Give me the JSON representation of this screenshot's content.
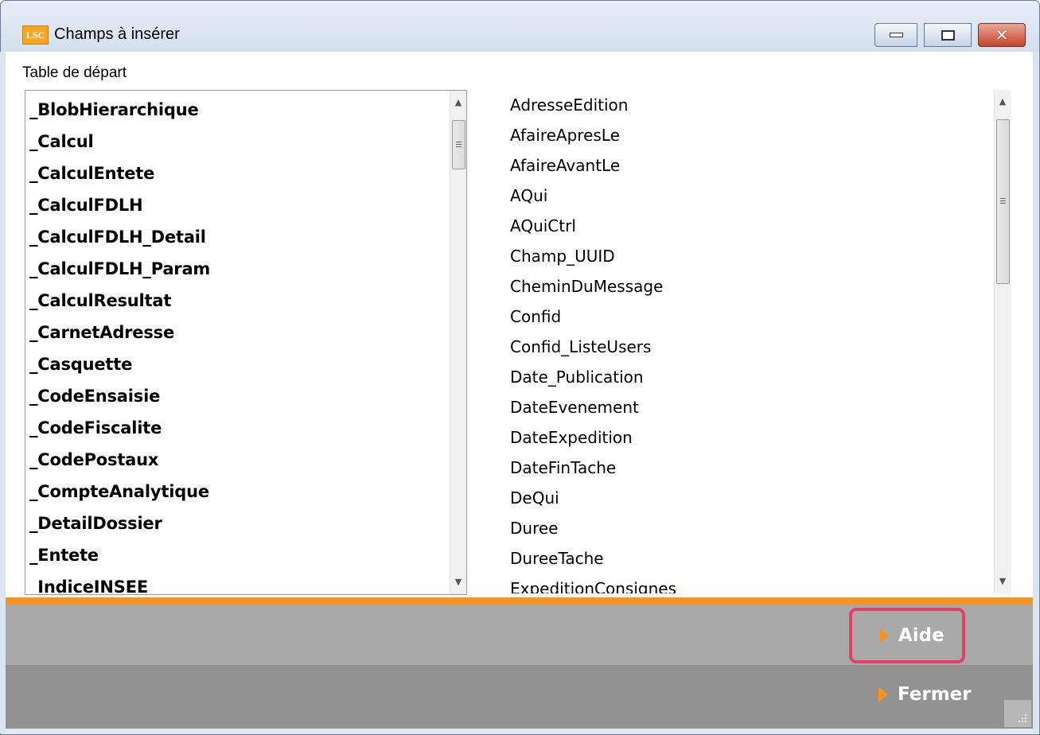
{
  "window": {
    "app_icon_text": "LSC",
    "title": "Champs à insérer"
  },
  "table_label": "Table de départ",
  "left_list": {
    "items": [
      "_BlobHierarchique",
      "_Calcul",
      "_CalculEntete",
      "_CalculFDLH",
      "_CalculFDLH_Detail",
      "_CalculFDLH_Param",
      "_CalculResultat",
      "_CarnetAdresse",
      "_Casquette",
      "_CodeEnsaisie",
      "_CodeFiscalite",
      "_CodePostaux",
      "_CompteAnalytique",
      "_DetailDossier",
      "_Entete",
      "_IndiceINSEE"
    ],
    "scroll_position": 0.05
  },
  "right_list": {
    "items": [
      "AdresseEdition",
      "AfaireApresLe",
      "AfaireAvantLe",
      "AQui",
      "AQuiCtrl",
      "Champ_UUID",
      "CheminDuMessage",
      "Confid",
      "Confid_ListeUsers",
      "Date_Publication",
      "DateEvenement",
      "DateExpedition",
      "DateFinTache",
      "DeQui",
      "Duree",
      "DureeTache",
      "ExpeditionConsignes"
    ],
    "scroll_position": 0.0
  },
  "buttons": {
    "aide": "Aide",
    "fermer": "Fermer"
  },
  "colors": {
    "accent": "#f7941d",
    "highlight": "#e83e6c"
  }
}
